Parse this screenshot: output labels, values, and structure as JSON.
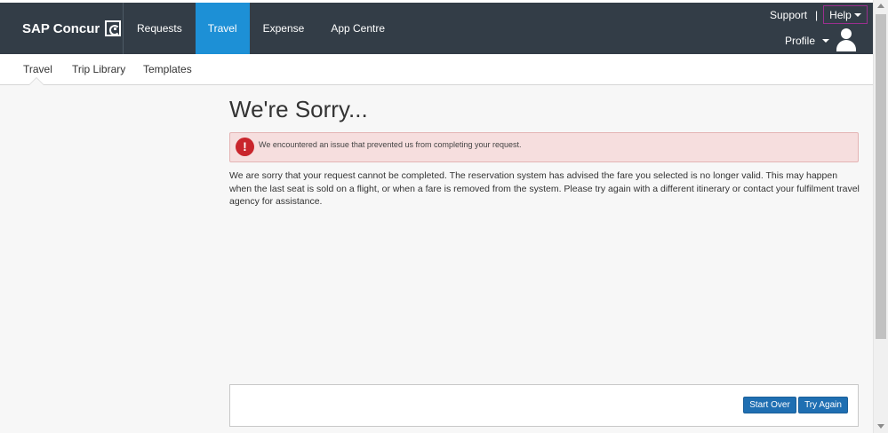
{
  "header": {
    "logo_text": "SAP Concur",
    "nav": [
      {
        "label": "Requests",
        "active": false
      },
      {
        "label": "Travel",
        "active": true
      },
      {
        "label": "Expense",
        "active": false
      },
      {
        "label": "App Centre",
        "active": false
      }
    ],
    "support_label": "Support",
    "separator": "|",
    "help_label": "Help",
    "profile_label": "Profile",
    "colors": {
      "bar": "#333d47",
      "active_tab": "#1d90d6",
      "help_outline": "#9b2f8f"
    }
  },
  "subnav": {
    "items": [
      {
        "label": "Travel",
        "active": true
      },
      {
        "label": "Trip Library",
        "active": false
      },
      {
        "label": "Templates",
        "active": false
      }
    ]
  },
  "main": {
    "title": "We're Sorry...",
    "alert": {
      "icon": "!",
      "text": "We encountered an issue that prevented us from completing your request."
    },
    "message": "We are sorry that your request cannot be completed. The reservation system has advised the fare you selected is no longer valid. This may happen when the last seat is sold on a flight, or when a fare is removed from the system. Please try again with a different itinerary or contact your fulfilment travel agency for assistance."
  },
  "footer": {
    "start_over_label": "Start Over",
    "try_again_label": "Try Again",
    "button_color": "#1f6fb2"
  }
}
